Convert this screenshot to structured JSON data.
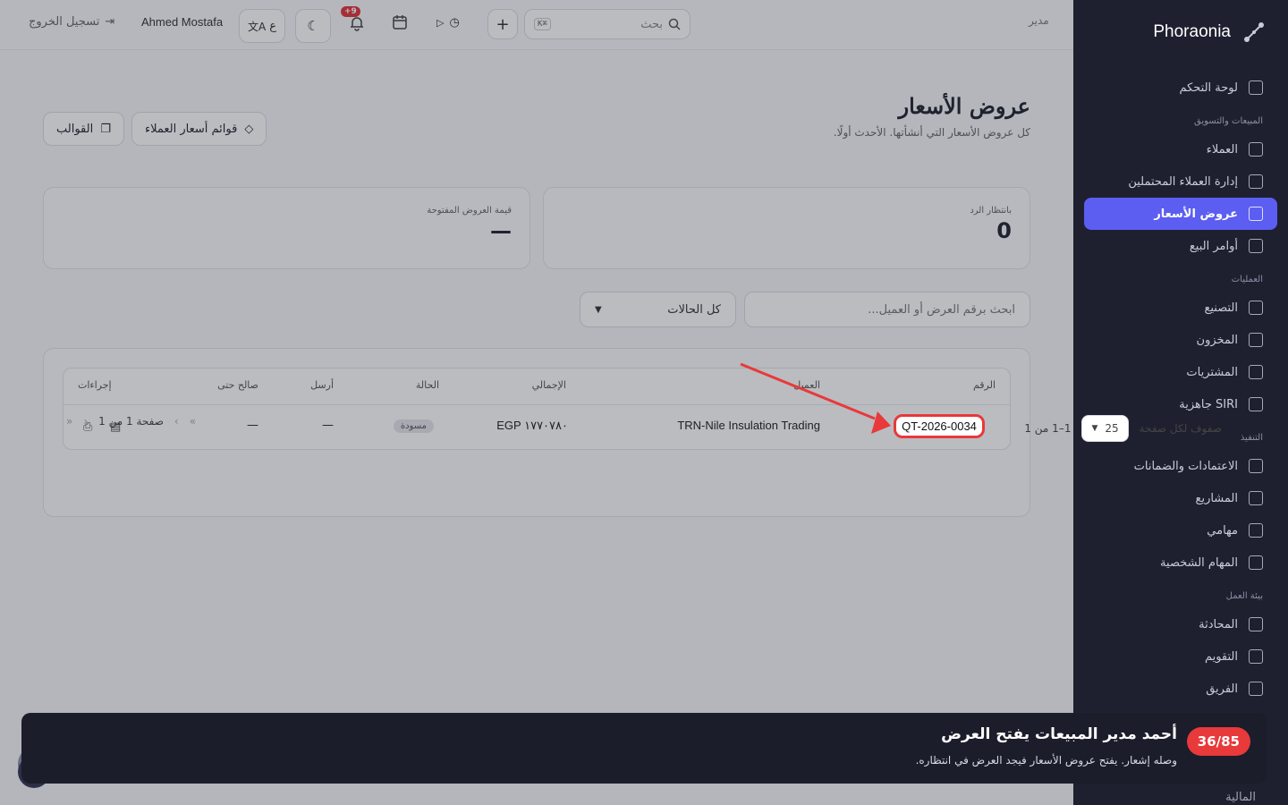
{
  "sidebar": {
    "brand": "Phoraonia",
    "items": [
      {
        "type": "item",
        "label": "لوحة التحكم",
        "icon": "dashboard-icon"
      },
      {
        "type": "section",
        "label": "المبيعات والتسويق"
      },
      {
        "type": "item",
        "label": "العملاء",
        "icon": "customers-icon"
      },
      {
        "type": "item",
        "label": "إدارة العملاء المحتملين",
        "icon": "target-icon"
      },
      {
        "type": "item",
        "label": "عروض الأسعار",
        "icon": "document-icon",
        "active": true
      },
      {
        "type": "item",
        "label": "أوامر البيع",
        "icon": "clipboard-icon"
      },
      {
        "type": "section",
        "label": "العمليات"
      },
      {
        "type": "item",
        "label": "التصنيع",
        "icon": "factory-icon"
      },
      {
        "type": "item",
        "label": "المخزون",
        "icon": "warehouse-icon"
      },
      {
        "type": "item",
        "label": "المشتريات",
        "icon": "cart-icon"
      },
      {
        "type": "item",
        "label": "SIRI جاهزية",
        "icon": "gauge-icon"
      },
      {
        "type": "section",
        "label": "التنفيذ"
      },
      {
        "type": "item",
        "label": "الاعتمادات والضمانات",
        "icon": "certificate-icon"
      },
      {
        "type": "item",
        "label": "المشاريع",
        "icon": "projects-icon"
      },
      {
        "type": "item",
        "label": "مهامي",
        "icon": "tasks-icon"
      },
      {
        "type": "item",
        "label": "المهام الشخصية",
        "icon": "personal-tasks-icon"
      },
      {
        "type": "section",
        "label": "بيئة العمل"
      },
      {
        "type": "item",
        "label": "المحادثة",
        "icon": "chat-icon"
      },
      {
        "type": "item",
        "label": "التقويم",
        "icon": "calendar-icon"
      },
      {
        "type": "item",
        "label": "الفريق",
        "icon": "team-icon"
      }
    ],
    "finance_label": "المالية"
  },
  "topbar": {
    "role": "مدير",
    "search_placeholder": "بحث",
    "shortcut": "K⌘",
    "notification_count": "+9",
    "user_name": "Ahmed Mostafa",
    "lang_label": "ع",
    "logout_label": "تسجيل الخروج"
  },
  "page": {
    "title": "عروض الأسعار",
    "subtitle": "كل عروض الأسعار التي أنشأتها. الأحدث أولًا.",
    "customer_price_lists_btn": "قوائم أسعار العملاء",
    "templates_btn": "القوالب"
  },
  "stats": {
    "awaiting_label": "بانتظار الرد",
    "awaiting_value": "0",
    "open_value_label": "قيمة العروض المفتوحة",
    "open_value_value": "—"
  },
  "filters": {
    "search_placeholder": "ابحث برقم العرض أو العميل...",
    "status_value": "كل الحالات"
  },
  "table": {
    "headers": {
      "number": "الرقم",
      "customer": "العميل",
      "total": "الإجمالي",
      "status": "الحالة",
      "sent": "أرسل",
      "valid_until": "صالح حتى",
      "actions": "إجراءات"
    },
    "rows": [
      {
        "number": "QT-2026-0034",
        "customer": "TRN-Nile Insulation Trading",
        "total": "EGP ١٧٧٠٧٨٠",
        "status": "مسودة",
        "sent": "—",
        "valid_until": "—"
      }
    ]
  },
  "pagination": {
    "rows_per_page_label": "صفوف لكل صفحة",
    "rows_per_page": "25",
    "range": "1–1 من 1",
    "page_info": "صفحة 1 من 1"
  },
  "tour": {
    "step": "36/85",
    "title": "أحمد مدير المبيعات يفتح العرض",
    "description": "وصله إشعار. يفتح عروض الأسعار فيجد العرض في انتظاره."
  },
  "colors": {
    "sidebar_bg": "#1e2030",
    "active_item": "#5b5ef0",
    "accent_red": "#e8393b"
  }
}
